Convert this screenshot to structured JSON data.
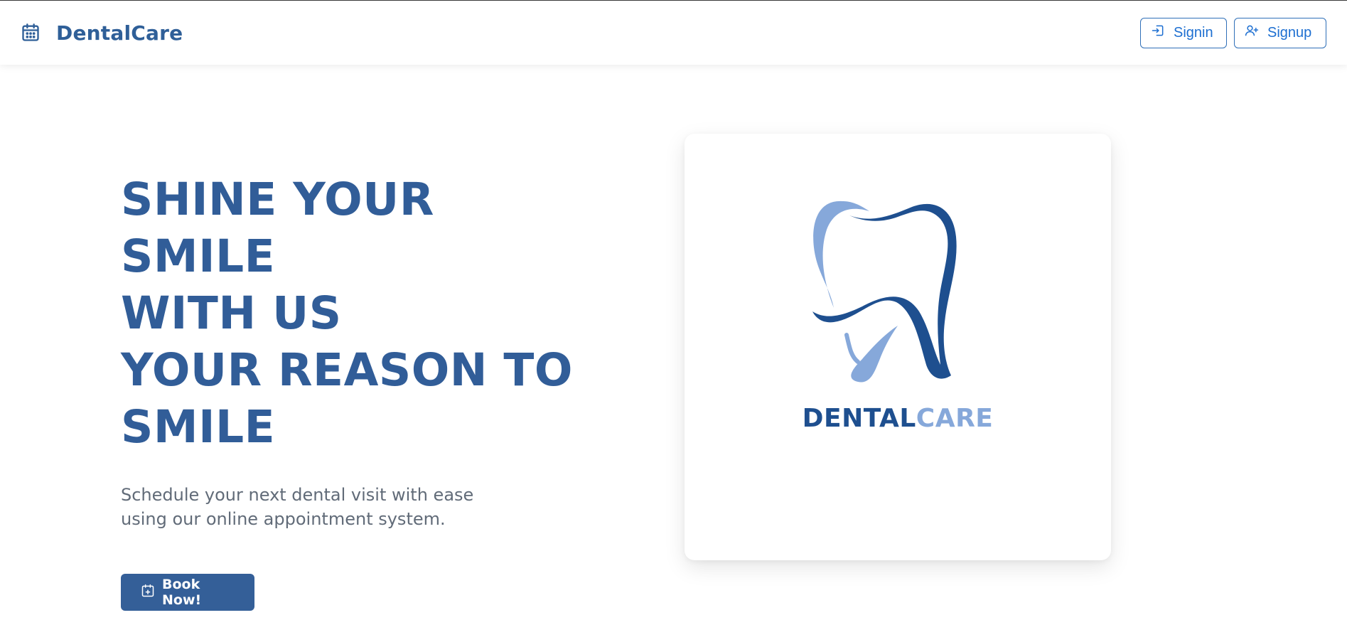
{
  "navbar": {
    "brand_name": "DentalCare",
    "brand_icon": "calendar-icon",
    "signin_label": "Signin",
    "signup_label": "Signup"
  },
  "hero": {
    "headline_lines": [
      "SHINE YOUR SMILE",
      "WITH US",
      "YOUR REASON TO",
      "SMILE"
    ],
    "subtext": "Schedule your next dental visit with ease using our online appointment system.",
    "book_label": "Book Now!"
  },
  "card": {
    "logo_text_primary": "DENTAL",
    "logo_text_secondary": "CARE"
  },
  "colors": {
    "brand": "#2f5f98",
    "accent": "#1d6fd1",
    "button": "#345f98",
    "logo_dark": "#1e4f8f",
    "logo_light": "#86a8da"
  }
}
